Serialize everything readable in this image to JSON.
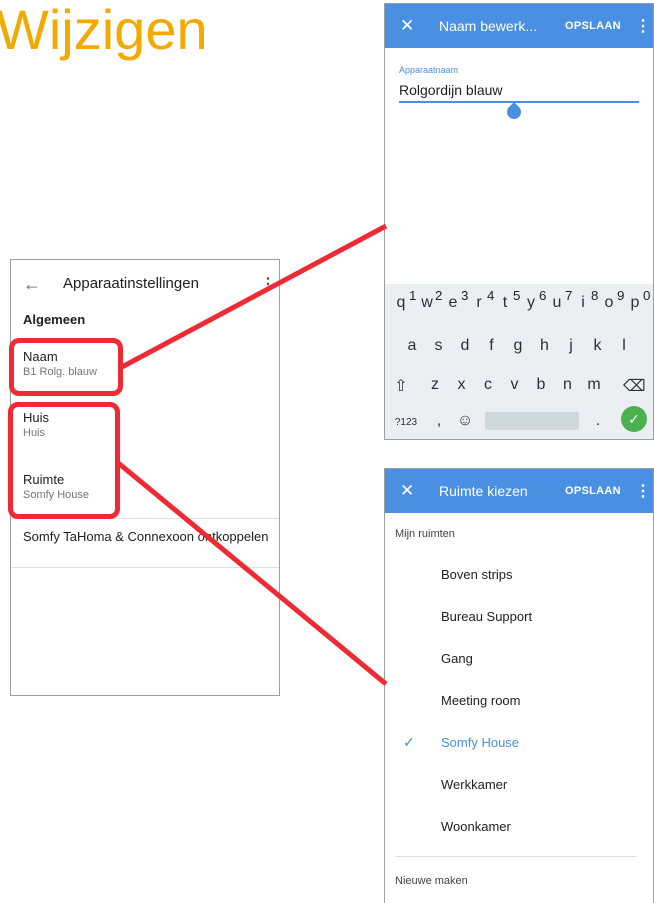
{
  "heading": "Wijzigen",
  "settings_screen": {
    "title": "Apparaatinstellingen",
    "back_icon": "arrow-left-icon",
    "more_icon": "more-vertical-icon",
    "section": "Algemeen",
    "items": [
      {
        "title": "Naam",
        "subtitle": "B1 Rolg. blauw"
      },
      {
        "title": "Huis",
        "subtitle": "Huis"
      },
      {
        "title": "Ruimte",
        "subtitle": "Somfy House"
      }
    ],
    "unlink_action": "Somfy TaHoma & Connexoon ontkoppelen"
  },
  "name_edit_screen": {
    "close_icon": "close-icon",
    "title": "Naam bewerk...",
    "save_label": "OPSLAAN",
    "more_icon": "more-vertical-icon",
    "field_label": "Apparaatnaam",
    "field_value": "Rolgordijn blauw",
    "keyboard": {
      "row1": [
        "q",
        "w",
        "e",
        "r",
        "t",
        "y",
        "u",
        "i",
        "o",
        "p"
      ],
      "row1_hints": [
        "1",
        "2",
        "3",
        "4",
        "5",
        "6",
        "7",
        "8",
        "9",
        "0"
      ],
      "row2": [
        "a",
        "s",
        "d",
        "f",
        "g",
        "h",
        "j",
        "k",
        "l"
      ],
      "row3": [
        "z",
        "x",
        "c",
        "v",
        "b",
        "n",
        "m"
      ],
      "shift_icon": "shift-icon",
      "backspace_icon": "backspace-icon",
      "symbols_label": "?123",
      "comma": ",",
      "emoji_icon": "emoji-icon",
      "period": ".",
      "enter_icon": "check-icon"
    }
  },
  "room_select_screen": {
    "close_icon": "close-icon",
    "title": "Ruimte kiezen",
    "save_label": "OPSLAAN",
    "more_icon": "more-vertical-icon",
    "section": "Mijn ruimten",
    "rooms": [
      "Boven strips",
      "Bureau Support",
      "Gang",
      "Meeting room",
      "Somfy House",
      "Werkkamer",
      "Woonkamer"
    ],
    "selected_room": "Somfy House",
    "new_label": "Nieuwe maken"
  },
  "colors": {
    "heading": "#f2a900",
    "app_bar": "#4a90e2",
    "highlight": "#ee2a35",
    "selected": "#4a90e2",
    "enter_key": "#4caf50"
  }
}
